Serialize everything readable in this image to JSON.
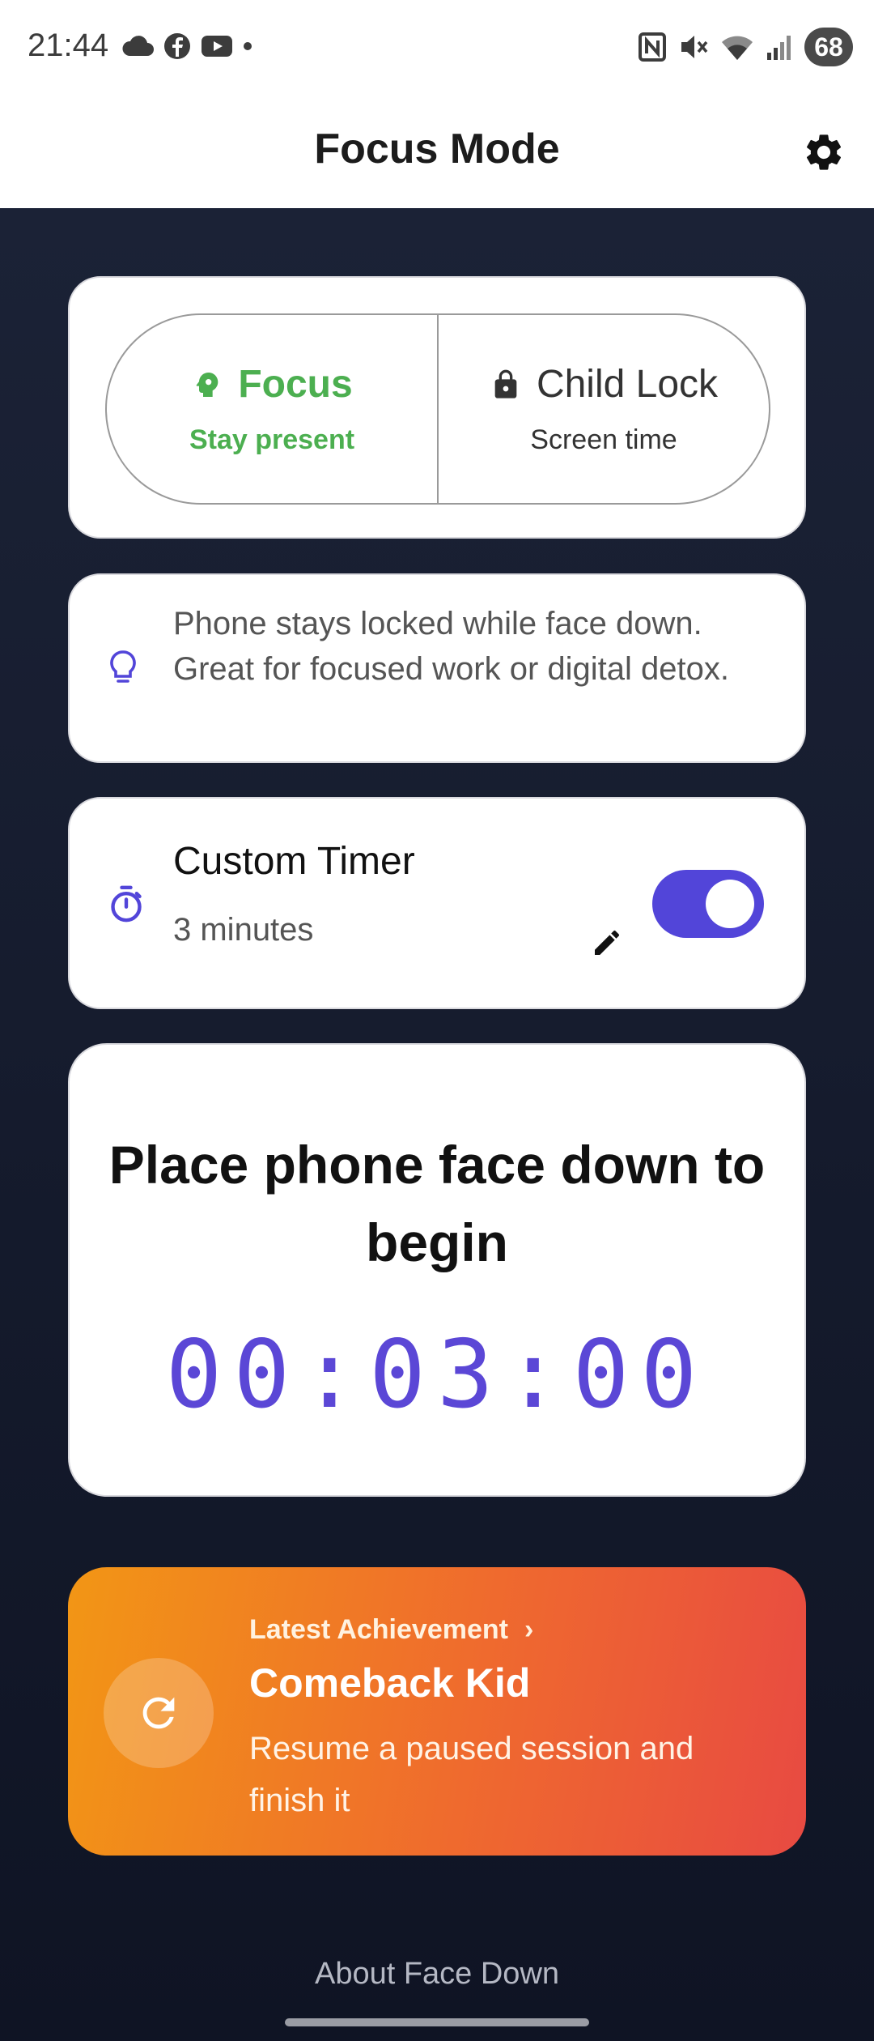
{
  "status_bar": {
    "time": "21:44",
    "left_icons": [
      "cloud-icon",
      "facebook-icon",
      "youtube-icon",
      "dot-icon"
    ],
    "right_icons": [
      "nfc-icon",
      "mute-icon",
      "wifi-icon",
      "signal-icon"
    ],
    "battery": "68"
  },
  "header": {
    "title": "Focus Mode",
    "settings_icon": "gear-icon"
  },
  "mode_selector": {
    "focus": {
      "label": "Focus",
      "sub": "Stay present",
      "icon": "brain-head-icon",
      "selected": true,
      "color": "#4caf50"
    },
    "child_lock": {
      "label": "Child Lock",
      "sub": "Screen time",
      "icon": "lock-icon",
      "selected": false
    }
  },
  "info": {
    "icon": "lightbulb-icon",
    "text": "Phone stays locked while face down. Great for focused work or digital detox."
  },
  "timer": {
    "icon": "stopwatch-icon",
    "title": "Custom Timer",
    "subtitle": "3 minutes",
    "edit_icon": "pencil-icon",
    "enabled": true,
    "accent": "#5245d9"
  },
  "countdown": {
    "prompt": "Place phone face down to begin",
    "value": "00:03:00",
    "color": "#5b47d6"
  },
  "achievement": {
    "label": "Latest Achievement",
    "chevron": "›",
    "title": "Comeback Kid",
    "description": "Resume a paused session and finish it",
    "icon": "refresh-icon"
  },
  "footer": {
    "about": "About Face Down"
  }
}
